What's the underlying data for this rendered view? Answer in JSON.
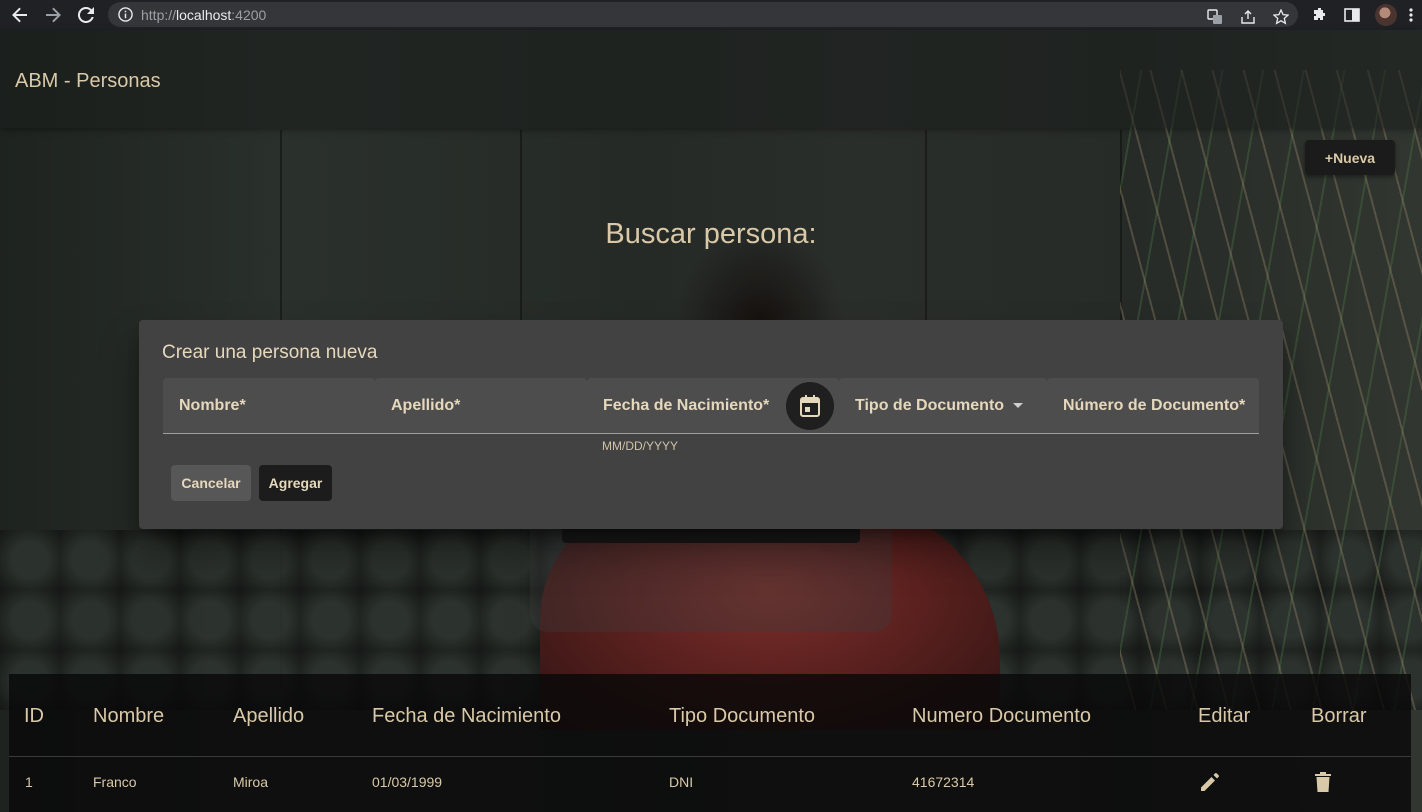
{
  "browser": {
    "url_scheme": "http://",
    "url_host": "localhost",
    "url_port": ":4200"
  },
  "app": {
    "title": "ABM - Personas",
    "new_button": "+Nueva",
    "search_title": "Buscar persona:"
  },
  "dialog": {
    "title": "Crear una persona nueva",
    "fields": {
      "nombre": "Nombre*",
      "apellido": "Apellido*",
      "fecha": "Fecha de Nacimiento*",
      "tipo": "Tipo de Documento",
      "numero": "Número de Documento*"
    },
    "date_hint": "MM/DD/YYYY",
    "cancel": "Cancelar",
    "add": "Agregar"
  },
  "table": {
    "headers": [
      "ID",
      "Nombre",
      "Apellido",
      "Fecha de Nacimiento",
      "Tipo Documento",
      "Numero Documento",
      "Editar",
      "Borrar"
    ],
    "rows": [
      [
        "1",
        "Franco",
        "Miroa",
        "01/03/1999",
        "DNI",
        "41672314"
      ]
    ]
  },
  "icons": {
    "calendar": "calendar-icon",
    "edit": "pencil-icon",
    "delete": "trash-icon"
  }
}
